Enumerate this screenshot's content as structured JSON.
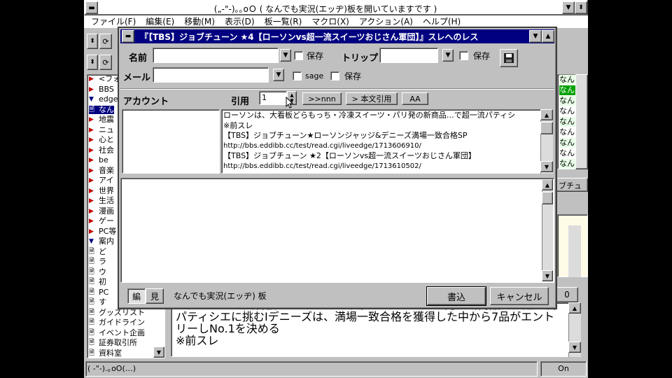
{
  "main_window": {
    "title": "(„-\"-)｡｡oＯ ( なんでも実況(エッヂ)板を開いていますです )",
    "menu": [
      "ファイル(F)",
      "編集(E)",
      "移動(M)",
      "表示(D)",
      "板一覧(R)",
      "マクロ(X)",
      "アクション(A)",
      "ヘルプ(H)"
    ],
    "status_left": "( -\"-).｡oO(…)",
    "status_right": "On",
    "right_tab_label": "ブチュ",
    "right_counter": "0"
  },
  "board_tree": {
    "items": [
      {
        "icon": "tri-red",
        "label": "<フォ"
      },
      {
        "icon": "tri-red",
        "label": "BBS"
      },
      {
        "icon": "tri-blue",
        "label": "edge"
      },
      {
        "icon": "doc",
        "label": "なん",
        "selected": true
      },
      {
        "icon": "tri-red",
        "label": "地震"
      },
      {
        "icon": "tri-red",
        "label": "ニュ"
      },
      {
        "icon": "tri-red",
        "label": "心と"
      },
      {
        "icon": "tri-red",
        "label": "社会"
      },
      {
        "icon": "tri-red",
        "label": "be"
      },
      {
        "icon": "tri-red",
        "label": "音楽"
      },
      {
        "icon": "tri-red",
        "label": "アイ"
      },
      {
        "icon": "tri-red",
        "label": "世界"
      },
      {
        "icon": "tri-red",
        "label": "生活"
      },
      {
        "icon": "tri-red",
        "label": "漫画"
      },
      {
        "icon": "tri-red",
        "label": "ゲー"
      },
      {
        "icon": "tri-red",
        "label": "PC等"
      },
      {
        "icon": "tri-blue",
        "label": "案内"
      },
      {
        "icon": "doc",
        "label": "ど"
      },
      {
        "icon": "doc",
        "label": "ラ"
      },
      {
        "icon": "doc",
        "label": "ウ"
      },
      {
        "icon": "doc",
        "label": "初"
      },
      {
        "icon": "doc",
        "label": "PC"
      },
      {
        "icon": "doc",
        "label": "す"
      },
      {
        "icon": "doc",
        "label": "グッズリスト"
      },
      {
        "icon": "doc",
        "label": "ガイドライン"
      },
      {
        "icon": "doc",
        "label": "イベント企画"
      },
      {
        "icon": "doc",
        "label": "証券取引所"
      },
      {
        "icon": "doc",
        "label": "資料室"
      }
    ]
  },
  "thread_list_peek": [
    "なん",
    "なん",
    "なん",
    "なん",
    "なん",
    "なん",
    "なん",
    "なん",
    "なん"
  ],
  "bg_message": {
    "line1": "ローソンは、大看板どらもっち・冷凍スイーツ・パリ発の新商品…で超一流",
    "line2": "パティシエに挑むIデニーズは、満場一致合格を獲得した中から7品がエント",
    "line3": "リーしNo.1を決める",
    "line4": "※前スレ"
  },
  "dialog": {
    "title": "『【TBS】ジョブチューン ★4【ローソンvs超一流スイーツおじさん軍団】』スレへのレス",
    "name_label": "名前",
    "name_value": "",
    "trip_label": "トリップ",
    "trip_value": "",
    "save_label": "保存",
    "mail_label": "メール",
    "mail_value": "",
    "sage_label": "sage",
    "account_label": "アカウント",
    "quote_label": "引用",
    "quote_value": "1",
    "nnn_button": ">>nnn",
    "body_quote_button": "> 本文引用",
    "aa_button": "AA",
    "quote_lines": [
      "ローソンは、大看板どらもっち・冷凍スイーツ・パリ発の新商品…で超一流パティシ",
      "※前スレ",
      "【TBS】ジョブチューン★ローソンジャッジ&デニーズ満場一致合格SP",
      "http://bbs.eddibb.cc/test/read.cgi/liveedge/1713606910/",
      "【TBS】ジョブチューン ★2【ローソンvs超一流スイーツおじさん軍団】",
      "http://bbs.eddibb.cc/test/read.cgi/liveedge/1713610502/"
    ],
    "body_text": "",
    "edit_tab": "編",
    "view_tab": "見",
    "board_name": "なんでも実況(エッヂ) 板",
    "submit_button": "書込",
    "cancel_button": "キャンセル"
  }
}
